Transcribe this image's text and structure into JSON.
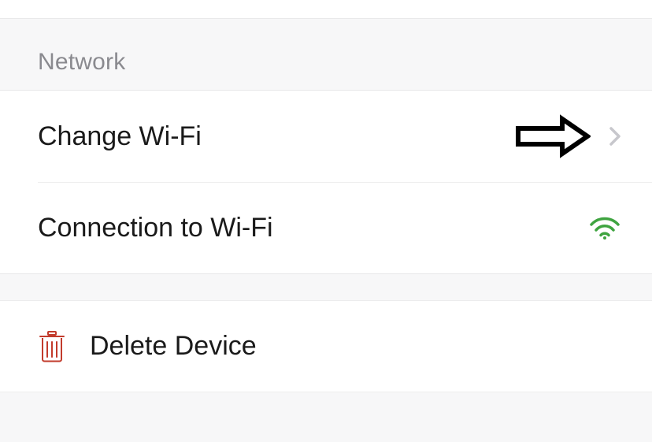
{
  "network": {
    "section_title": "Network",
    "change_wifi": {
      "label": "Change Wi-Fi"
    },
    "connection": {
      "label": "Connection to Wi-Fi",
      "status": "connected"
    }
  },
  "delete": {
    "label": "Delete Device"
  }
}
